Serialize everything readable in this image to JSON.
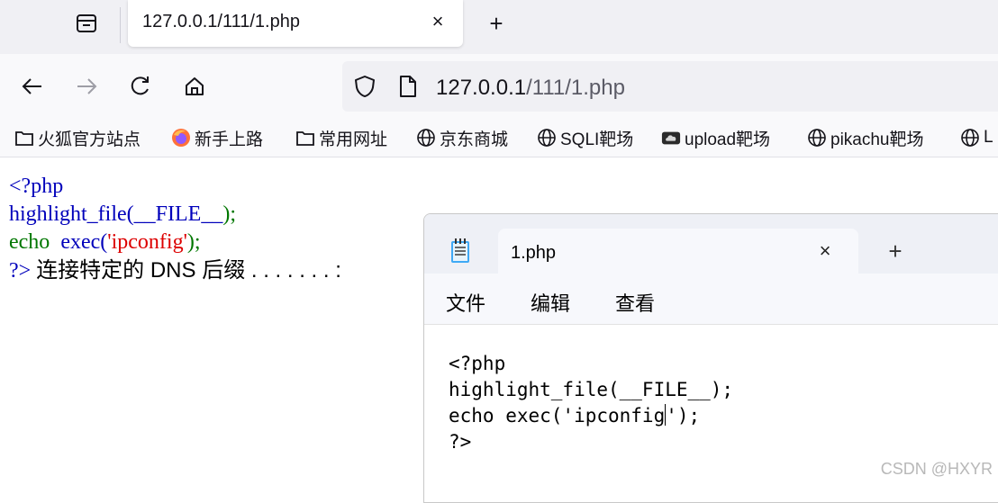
{
  "browser": {
    "tab": {
      "title": "127.0.0.1/111/1.php",
      "close_glyph": "×"
    },
    "new_tab_glyph": "+",
    "url": {
      "host": "127.0.0.1",
      "path": "/111/1.php"
    },
    "bookmarks": [
      {
        "label": "火狐官方站点",
        "icon": "folder-icon"
      },
      {
        "label": "新手上路",
        "icon": "firefox-icon"
      },
      {
        "label": "常用网址",
        "icon": "folder-icon"
      },
      {
        "label": "京东商城",
        "icon": "globe-icon"
      },
      {
        "label": "SQLI靶场",
        "icon": "globe-icon"
      },
      {
        "label": "upload靶场",
        "icon": "cloud-icon"
      },
      {
        "label": "pikachu靶场",
        "icon": "globe-icon"
      },
      {
        "label": "L",
        "icon": "globe-icon"
      }
    ]
  },
  "page": {
    "lines": {
      "l1": "<?php",
      "l2a": "highlight_file(",
      "l2b": "__FILE__",
      "l2c": ");",
      "l3a": "echo",
      "l3b": "exec(",
      "l3c": "'ipconfig'",
      "l3d": ");",
      "l4a": "?>",
      "l4b": "连接特定的 DNS 后缀 . . . . . . . :"
    }
  },
  "notepad": {
    "tab_title": "1.php",
    "close_glyph": "×",
    "new_tab_glyph": "+",
    "menu": [
      "文件",
      "编辑",
      "查看"
    ],
    "code": {
      "l1": "<?php",
      "l2": "highlight_file(__FILE__);",
      "l3a": "echo exec('ipconfig",
      "l3b": "');",
      "l4": "?>"
    }
  },
  "watermark": "CSDN @HXYR",
  "colors": {
    "php_blue": "#0000bb",
    "php_green": "#007700",
    "php_red": "#dd0000"
  }
}
